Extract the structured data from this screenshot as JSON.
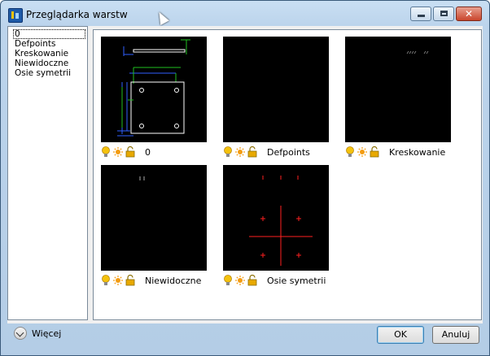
{
  "window": {
    "title": "Przeglądarka warstw"
  },
  "layers": [
    "0",
    "Defpoints",
    "Kreskowanie",
    "Niewidoczne",
    "Osie symetrii"
  ],
  "thumbnails": [
    {
      "name": "0"
    },
    {
      "name": "Defpoints"
    },
    {
      "name": "Kreskowanie"
    },
    {
      "name": "Niewidoczne"
    },
    {
      "name": "Osie symetrii"
    }
  ],
  "layer_state_icons": [
    "lightbulb-on-icon",
    "sun-thaw-icon",
    "padlock-unlocked-icon"
  ],
  "footer": {
    "more_label": "Więcej",
    "ok_label": "OK",
    "cancel_label": "Anuluj"
  },
  "colors": {
    "bulb": "#f4c20d",
    "sun": "#f39c12",
    "lock": "#e8a900",
    "preview_bg": "#000000",
    "geometry_red": "#ff2020",
    "geometry_blue": "#3060ff",
    "geometry_green": "#20c020"
  }
}
